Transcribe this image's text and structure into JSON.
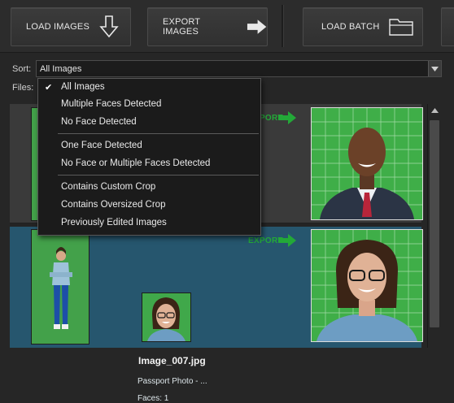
{
  "toolbar": {
    "load_images": "LOAD IMAGES",
    "export_images": "EXPORT IMAGES",
    "load_batch": "LOAD BATCH"
  },
  "sort": {
    "label": "Sort:",
    "value": "All Images"
  },
  "files": {
    "label": "Files:"
  },
  "dropdown": {
    "selected": "All Images",
    "groups": [
      [
        "All Images",
        "Multiple Faces Detected",
        "No Face Detected"
      ],
      [
        "One Face Detected",
        "No Face or Multiple Faces Detected"
      ],
      [
        "Contains Custom Crop",
        "Contains Oversized Crop",
        "Previously Edited Images"
      ]
    ]
  },
  "rows": [
    {
      "export_label": "EXPORT"
    },
    {
      "filename": "Image_007.jpg",
      "photo_type": "Passport Photo - ...",
      "faces": "Faces: 1",
      "export_label": "EXPORT"
    }
  ],
  "colors": {
    "accent_green": "#23a838",
    "selected_row": "#26566e",
    "background": "#262626"
  }
}
